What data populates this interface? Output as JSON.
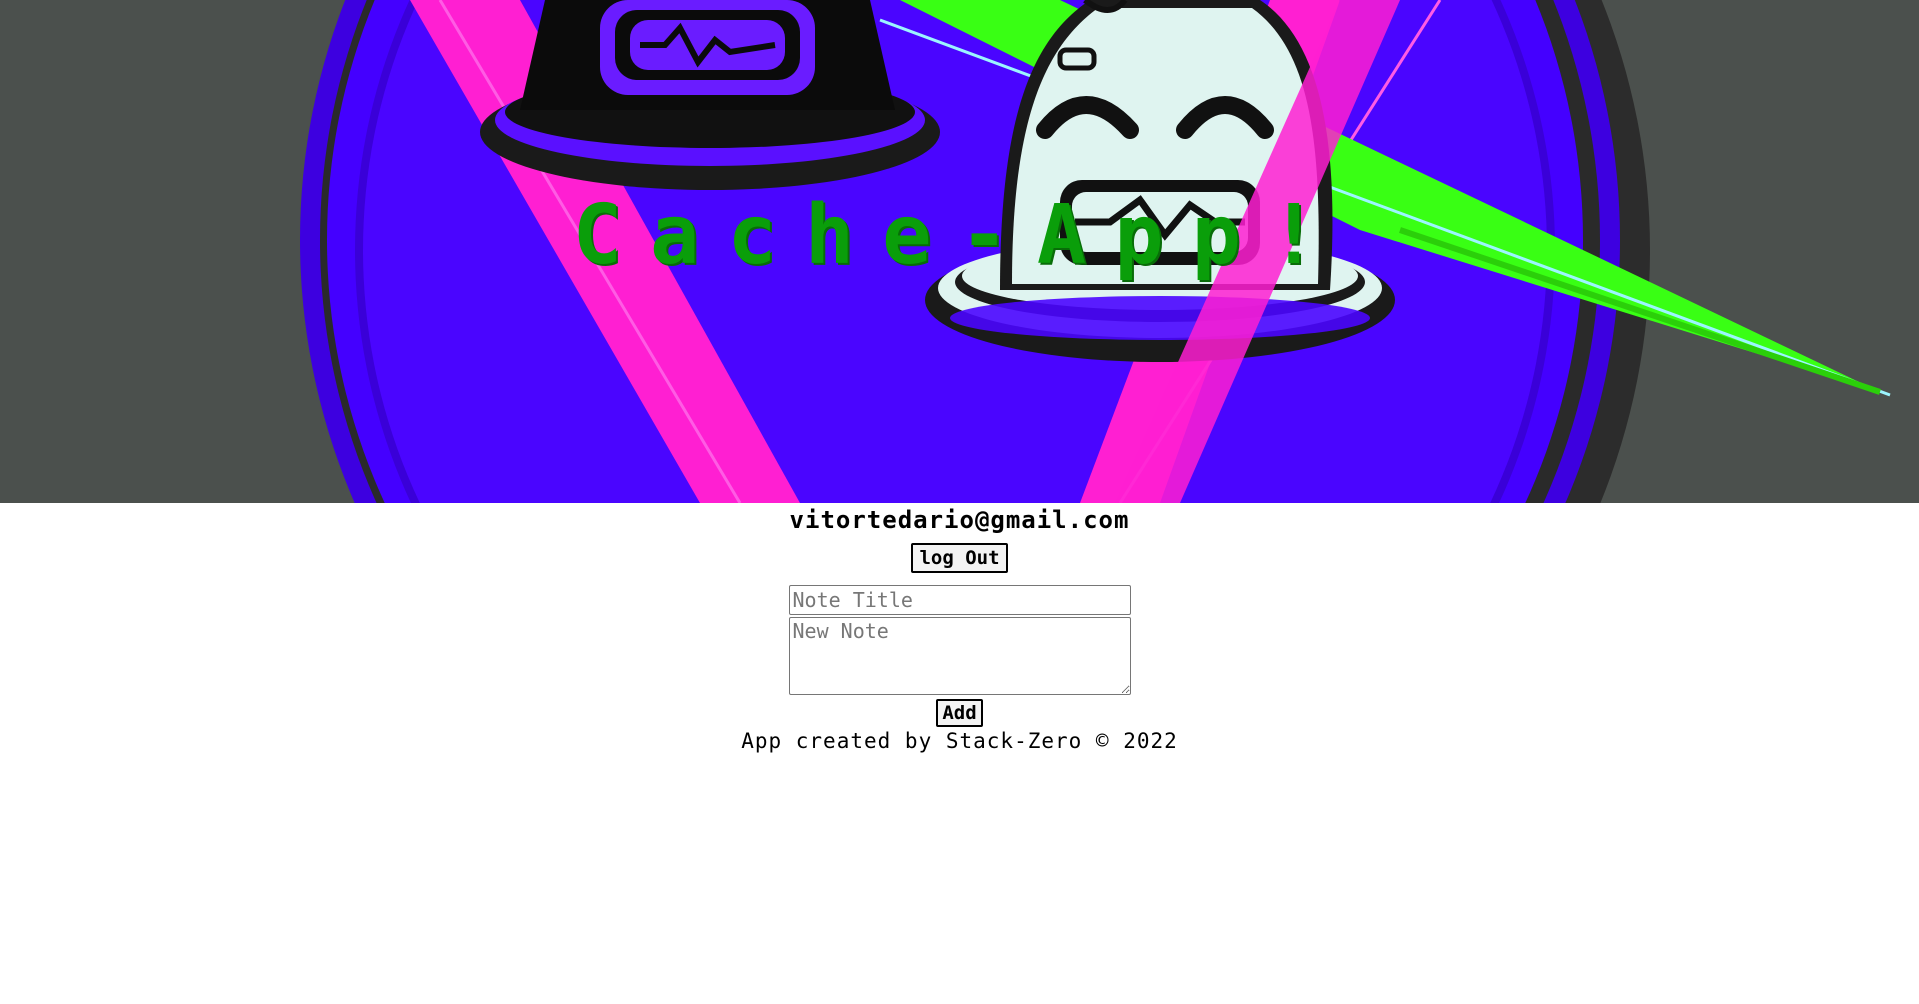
{
  "app": {
    "title": "Cache-App!"
  },
  "user": {
    "email": "vitortedario@gmail.com"
  },
  "auth": {
    "logout_label": "log Out"
  },
  "note_form": {
    "title_placeholder": "Note Title",
    "body_placeholder": "New Note",
    "add_label": "Add"
  },
  "footer": {
    "text": "App created by Stack-Zero © 2022"
  },
  "colors": {
    "title_green": "#0a9e0a",
    "hero_purple": "#4400ff",
    "hero_magenta": "#ff1fd2",
    "hero_lime": "#39ff14",
    "hero_gray": "#4a4f4c"
  }
}
